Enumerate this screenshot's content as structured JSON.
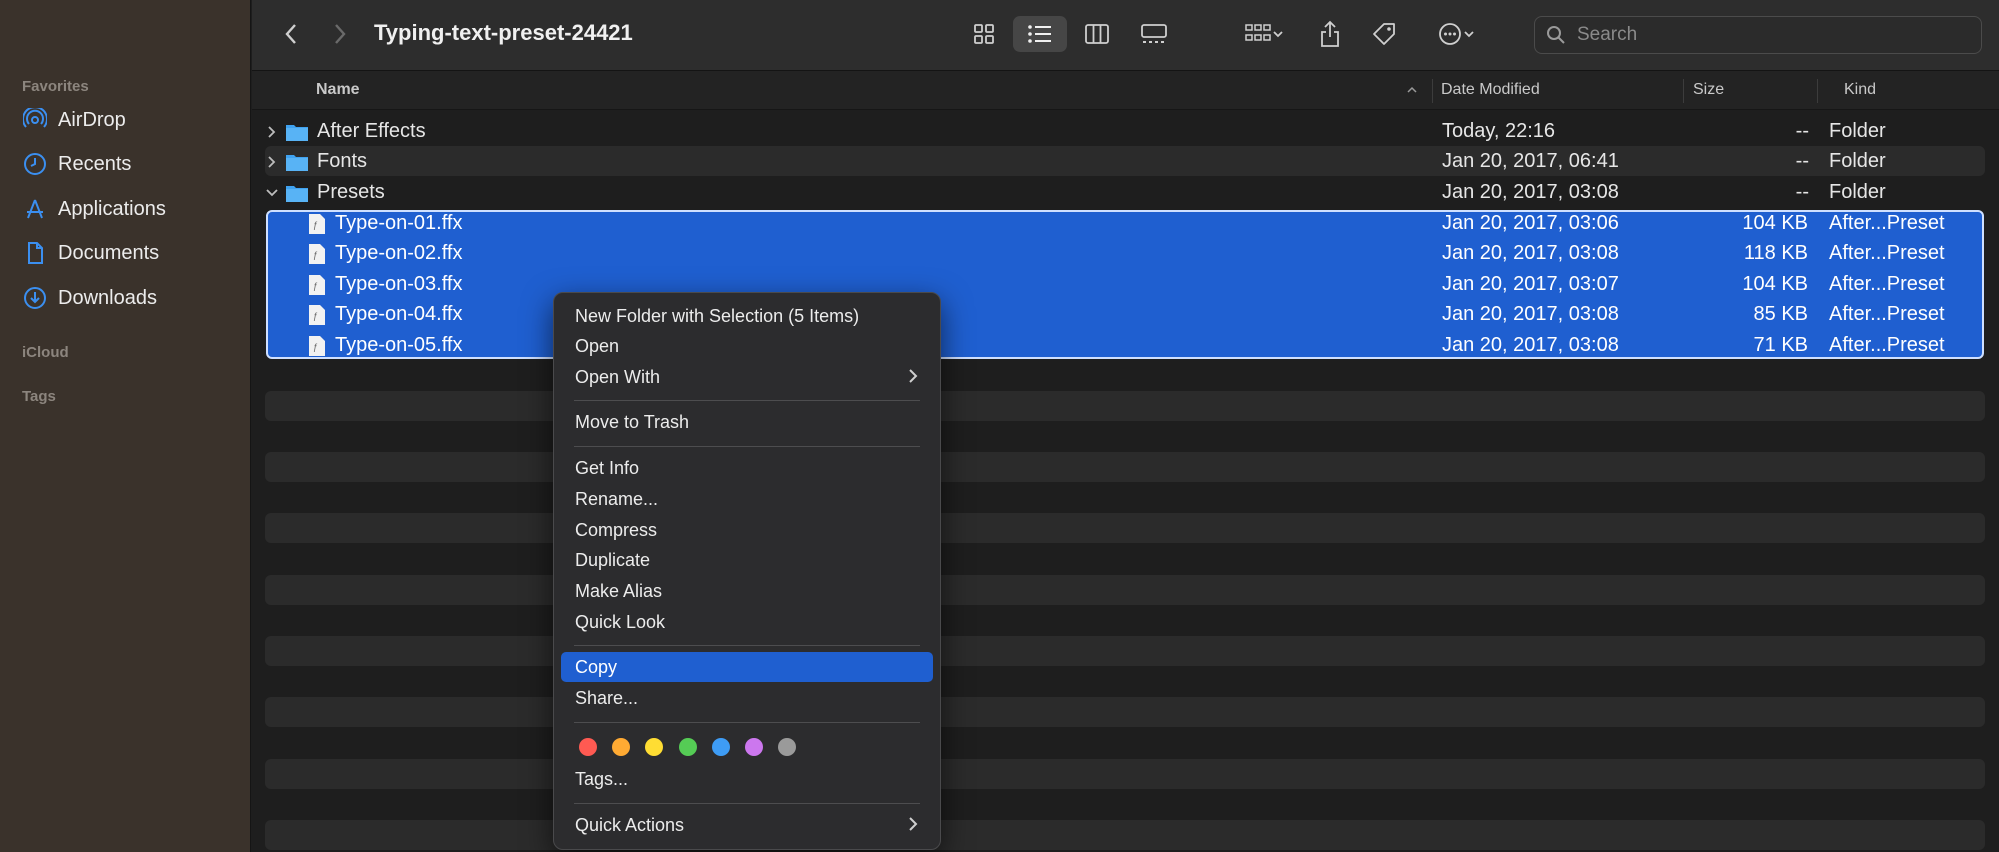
{
  "window": {
    "title": "Typing-text-preset-24421"
  },
  "sidebar": {
    "favorites_label": "Favorites",
    "items": [
      {
        "label": "AirDrop",
        "icon": "airdrop-icon"
      },
      {
        "label": "Recents",
        "icon": "clock-icon"
      },
      {
        "label": "Applications",
        "icon": "applications-icon"
      },
      {
        "label": "Documents",
        "icon": "document-icon"
      },
      {
        "label": "Downloads",
        "icon": "download-icon"
      }
    ],
    "icloud_label": "iCloud",
    "tags_label": "Tags"
  },
  "toolbar": {
    "search_placeholder": "Search",
    "accent_color": "#1f5fd0"
  },
  "columns": {
    "name": "Name",
    "date": "Date Modified",
    "size": "Size",
    "kind": "Kind"
  },
  "rows": [
    {
      "name": "After Effects",
      "date": "Today, 22:16",
      "size": "--",
      "kind": "Folder",
      "type": "folder",
      "expanded": false
    },
    {
      "name": "Fonts",
      "date": "Jan 20, 2017, 06:41",
      "size": "--",
      "kind": "Folder",
      "type": "folder",
      "expanded": false
    },
    {
      "name": "Presets",
      "date": "Jan 20, 2017, 03:08",
      "size": "--",
      "kind": "Folder",
      "type": "folder",
      "expanded": true
    }
  ],
  "selected_files": [
    {
      "name": "Type-on-01.ffx",
      "date": "Jan 20, 2017, 03:06",
      "size": "104 KB",
      "kind": "After...Preset"
    },
    {
      "name": "Type-on-02.ffx",
      "date": "Jan 20, 2017, 03:08",
      "size": "118 KB",
      "kind": "After...Preset"
    },
    {
      "name": "Type-on-03.ffx",
      "date": "Jan 20, 2017, 03:07",
      "size": "104 KB",
      "kind": "After...Preset"
    },
    {
      "name": "Type-on-04.ffx",
      "date": "Jan 20, 2017, 03:08",
      "size": "85 KB",
      "kind": "After...Preset"
    },
    {
      "name": "Type-on-05.ffx",
      "date": "Jan 20, 2017, 03:08",
      "size": "71 KB",
      "kind": "After...Preset"
    }
  ],
  "context_menu": {
    "new_folder": "New Folder with Selection (5 Items)",
    "open": "Open",
    "open_with": "Open With",
    "move_to_trash": "Move to Trash",
    "get_info": "Get Info",
    "rename": "Rename...",
    "compress": "Compress",
    "duplicate": "Duplicate",
    "make_alias": "Make Alias",
    "quick_look": "Quick Look",
    "copy": "Copy",
    "share": "Share...",
    "tags": "Tags...",
    "quick_actions": "Quick Actions",
    "tag_colors": [
      "#ff5a52",
      "#ffaa33",
      "#ffdd33",
      "#55cc55",
      "#3e9cf5",
      "#cc77ee",
      "#9a9a9a"
    ]
  }
}
